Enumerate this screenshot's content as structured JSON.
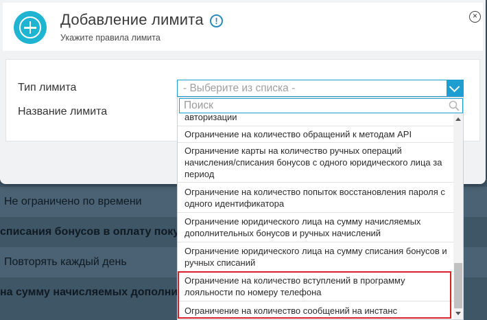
{
  "background": {
    "rows": [
      "Не ограничено по времени",
      "списания бонусов в оплату покупки",
      "Повторять каждый день",
      "на сумму начисляемых дополнител"
    ]
  },
  "modal": {
    "title": "Добавление лимита",
    "subtitle": "Укажите правила лимита",
    "info_icon": "!",
    "close_icon": "×",
    "fields": {
      "type_label": "Тип лимита",
      "name_label": "Название лимита"
    },
    "select": {
      "value": "- Выберите из списка -"
    },
    "dropdown": {
      "search_placeholder": "Поиск",
      "items": [
        "авторизации",
        "Ограничение на количество обращений к методам API",
        "Ограничение карты на количество ручных операций начисления/списания бонусов с одного юридического лица за период",
        "Ограничение на количество попыток восстановления пароля с одного идентификатора",
        "Ограничение юридического лица на сумму начисляемых дополнительных бонусов и ручных начислений",
        "Ограничение юридического лица на сумму списания бонусов и ручных списаний",
        "Ограничение на количество вступлений в программу лояльности по номеру телефона",
        "Ограничение на количество сообщений на инстанс"
      ]
    }
  },
  "colors": {
    "accent": "#1c9ed0",
    "icon_bg": "#1fb5d2",
    "highlight": "#d8202a",
    "backdrop": "#3f5667"
  }
}
